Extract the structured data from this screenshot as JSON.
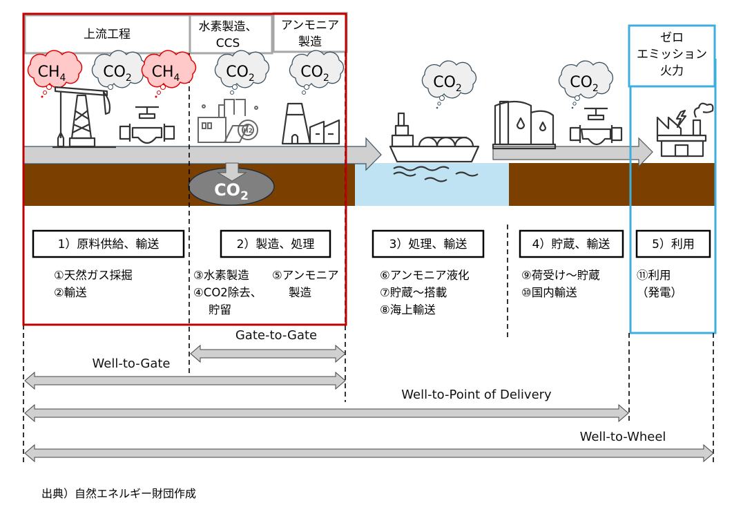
{
  "headers": {
    "upstream": "上流工程",
    "hydrogen_line1": "水素製造、",
    "hydrogen_line2": "CCS",
    "ammonia_line1": "アンモニア",
    "ammonia_line2": "製造",
    "zero_line1": "ゼロ",
    "zero_line2": "エミッション",
    "zero_line3": "火力"
  },
  "clouds": [
    {
      "base": "CH",
      "sub": "4",
      "type": "methane"
    },
    {
      "base": "CO",
      "sub": "2",
      "type": "co2"
    },
    {
      "base": "CH",
      "sub": "4",
      "type": "methane"
    },
    {
      "base": "CO",
      "sub": "2",
      "type": "co2"
    },
    {
      "base": "CO",
      "sub": "2",
      "type": "co2"
    },
    {
      "base": "CO",
      "sub": "2",
      "type": "co2"
    },
    {
      "base": "CO",
      "sub": "2",
      "type": "co2"
    }
  ],
  "storage": {
    "base": "CO",
    "sub": "2"
  },
  "steps": [
    {
      "label": "1）原料供給、輸送",
      "items": [
        "①天然ガス採掘",
        "②輸送"
      ]
    },
    {
      "label": "2）製造、処理",
      "items": [
        "③水素製造",
        "④CO2除去、",
        "貯留",
        "⑤アンモニア",
        "製造"
      ]
    },
    {
      "label": "3）処理、輸送",
      "items": [
        "⑥アンモニア液化",
        "⑦貯蔵～搭載",
        "⑧海上輸送"
      ]
    },
    {
      "label": "4）貯蔵、輸送",
      "items": [
        "⑨荷受け～貯蔵",
        "⑩国内輸送"
      ]
    },
    {
      "label": "5）利用",
      "items": [
        "⑪利用",
        "（発電）"
      ]
    }
  ],
  "ranges": {
    "gate_to_gate": "Gate-to-Gate",
    "well_to_gate": "Well-to-Gate",
    "well_to_pod": "Well-to-Point of Delivery",
    "well_to_wheel": "Well-to-Wheel"
  },
  "source": "出典）自然エネルギー財団作成",
  "colors": {
    "scope_box": "#c00000",
    "zero_box": "#3daee0",
    "ground": "#7b3f00",
    "sea": "#bfe3f2",
    "methane_cloud": "#ffc9c9",
    "co2_cloud": "#efefef",
    "storage": "#808080",
    "arrow": "#d0d0d0"
  },
  "icons": [
    "pumpjack-icon",
    "valve-icon",
    "hydrogen-plant-icon",
    "ammonia-plant-icon",
    "lng-ship-icon",
    "storage-tank-icon",
    "valve-icon",
    "power-plant-icon"
  ]
}
